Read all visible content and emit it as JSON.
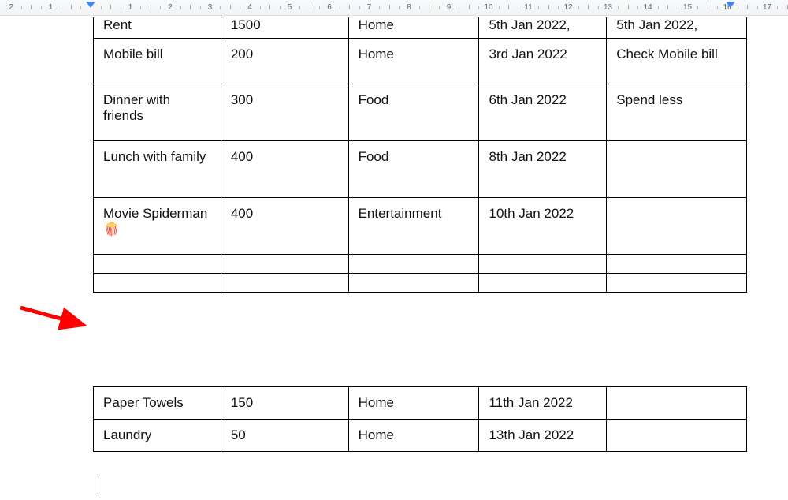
{
  "ruler": {
    "numbers": [
      "2",
      "1",
      "1",
      "2",
      "3",
      "4",
      "5",
      "6",
      "7",
      "8",
      "9",
      "10",
      "11",
      "12",
      "13",
      "14",
      "15",
      "16",
      "17"
    ]
  },
  "table1": {
    "rows": [
      {
        "c1": "Rent",
        "c2": "1500",
        "c3": "Home",
        "c4": "5th Jan 2022,",
        "c5": "5th Jan 2022,",
        "cls": "row-cut"
      },
      {
        "c1": "Mobile bill",
        "c2": "200",
        "c3": "Home",
        "c4": "3rd Jan 2022",
        "c5": "Check Mobile bill",
        "cls": "row-med"
      },
      {
        "c1": "Dinner with friends",
        "c2": "300",
        "c3": "Food",
        "c4": "6th Jan 2022",
        "c5": "Spend less",
        "cls": "row-tall"
      },
      {
        "c1": "Lunch with family",
        "c2": "400",
        "c3": "Food",
        "c4": "8th Jan 2022",
        "c5": "",
        "cls": "row-tall"
      },
      {
        "c1": "Movie Spiderman 🍿",
        "c2": "400",
        "c3": "Entertainment",
        "c4": "10th Jan 2022",
        "c5": "",
        "cls": "row-tall"
      },
      {
        "c1": "",
        "c2": "",
        "c3": "",
        "c4": "",
        "c5": "",
        "cls": "row-empty"
      },
      {
        "c1": "",
        "c2": "",
        "c3": "",
        "c4": "",
        "c5": "",
        "cls": "row-empty"
      }
    ]
  },
  "table2": {
    "rows": [
      {
        "c1": "Paper Towels",
        "c2": "150",
        "c3": "Home",
        "c4": "11th Jan 2022",
        "c5": "",
        "cls": ""
      },
      {
        "c1": "Laundry",
        "c2": "50",
        "c3": "Home",
        "c4": "13th Jan 2022",
        "c5": "",
        "cls": ""
      }
    ]
  }
}
